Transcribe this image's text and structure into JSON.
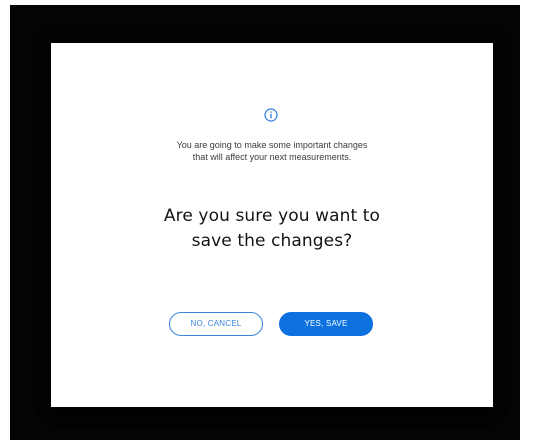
{
  "dialog": {
    "icon": "info-circle-icon",
    "message_line1": "You are going to make some important changes",
    "message_line2": "that will affect your next measurements.",
    "question_line1": "Are you sure you want to",
    "question_line2": "save the changes?",
    "cancel_label": "NO, CANCEL",
    "save_label": "YES, SAVE"
  },
  "colors": {
    "accent": "#0d71df",
    "backdrop": "#040404",
    "surface": "#ffffff"
  }
}
